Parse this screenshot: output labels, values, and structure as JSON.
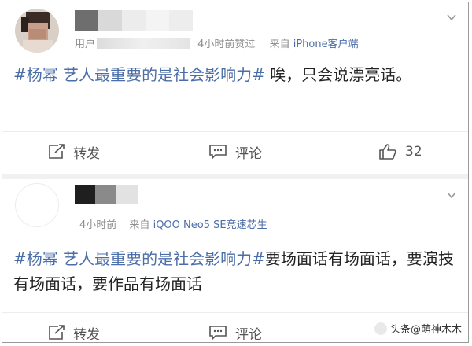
{
  "post1": {
    "meta_prefix": "用户",
    "time_action": "4小时前赞过",
    "source_prefix": "来自",
    "source": "iPhone客户端",
    "hashtag": "#杨幂 艺人最重要的是社会影响力#",
    "text": " 唉，只会说漂亮话。",
    "actions": {
      "repost": "转发",
      "comment": "评论",
      "like_count": "32"
    }
  },
  "post2": {
    "time": "4小时前",
    "source_prefix": "来自",
    "source": "iQOO Neo5 SE竞速芯生",
    "hashtag": "#杨幂 艺人最重要的是社会影响力#",
    "text": "要场面话有场面话，要演技有场面话，要作品有场面话",
    "actions": {
      "repost": "转发",
      "comment": "评论"
    }
  },
  "watermark": "头条@萌神木木",
  "icons": [
    "chevron-down-icon",
    "repost-icon",
    "comment-icon",
    "like-icon"
  ],
  "colors": {
    "link": "#4c6ea8",
    "text": "#222222",
    "meta": "#8f8f8f"
  }
}
